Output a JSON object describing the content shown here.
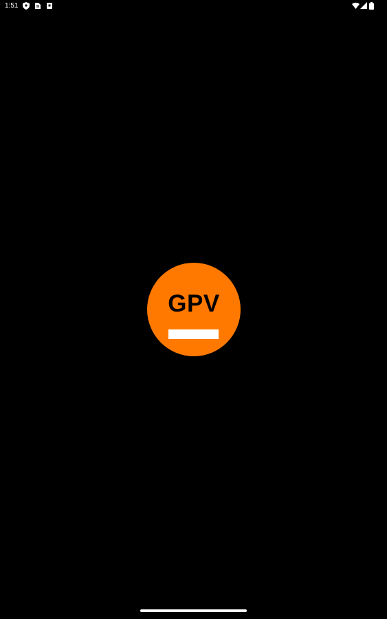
{
  "status_bar": {
    "time": "1:51",
    "left_icons": [
      "shield-icon",
      "document-icon",
      "square-notification-icon"
    ],
    "right_icons": [
      "wifi-icon",
      "cell-signal-icon",
      "battery-icon"
    ]
  },
  "splash": {
    "logo_text": "GPV",
    "logo_color": "#FF7900",
    "background": "#000000"
  },
  "nav": {
    "type": "gesture-handle"
  }
}
